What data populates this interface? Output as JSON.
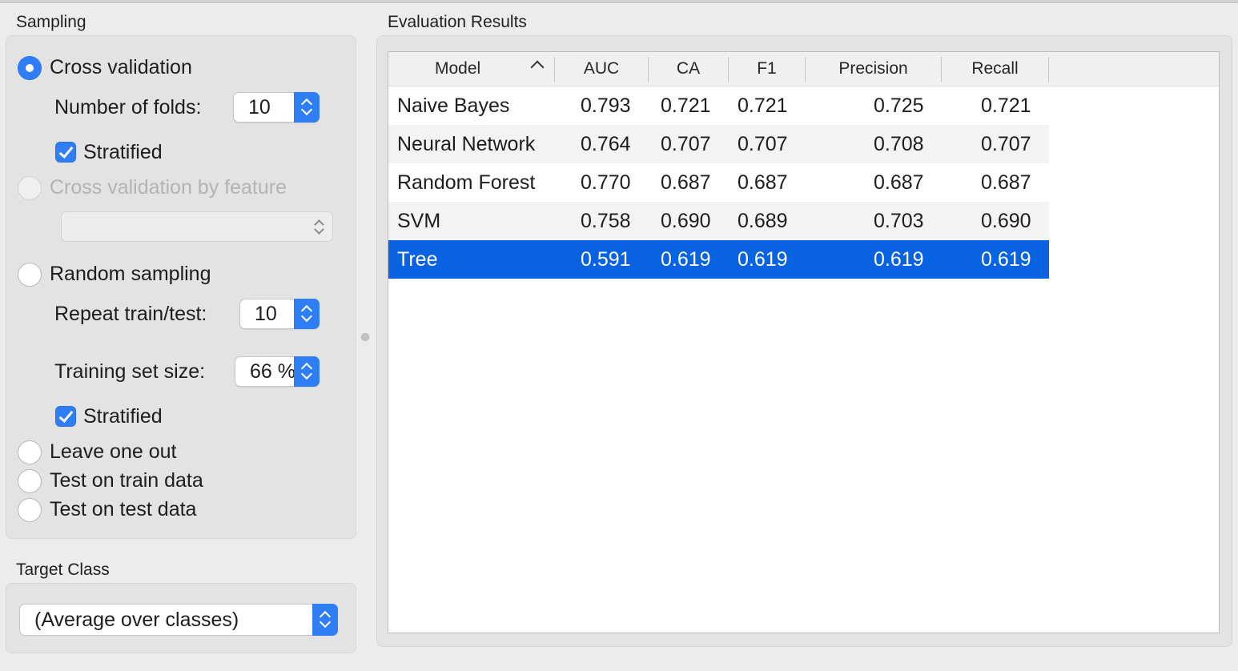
{
  "sampling": {
    "title": "Sampling",
    "cross_validation": {
      "label": "Cross validation",
      "folds_label": "Number of folds:",
      "folds_value": "10",
      "stratified_label": "Stratified"
    },
    "cv_by_feature": {
      "label": "Cross validation by feature",
      "value": ""
    },
    "random_sampling": {
      "label": "Random sampling",
      "repeat_label": "Repeat train/test:",
      "repeat_value": "10",
      "size_label": "Training set size:",
      "size_value": "66 %",
      "stratified_label": "Stratified"
    },
    "leave_one_out": {
      "label": "Leave one out"
    },
    "test_on_train": {
      "label": "Test on train data"
    },
    "test_on_test": {
      "label": "Test on test data"
    },
    "selected": "Cross validation"
  },
  "target_class": {
    "title": "Target Class",
    "value": "(Average over classes)"
  },
  "results": {
    "title": "Evaluation Results",
    "columns": [
      "Model",
      "AUC",
      "CA",
      "F1",
      "Precision",
      "Recall"
    ],
    "sort_column": "Model",
    "rows": [
      [
        "Naive Bayes",
        "0.793",
        "0.721",
        "0.721",
        "0.725",
        "0.721"
      ],
      [
        "Neural Network",
        "0.764",
        "0.707",
        "0.707",
        "0.708",
        "0.707"
      ],
      [
        "Random Forest",
        "0.770",
        "0.687",
        "0.687",
        "0.687",
        "0.687"
      ],
      [
        "SVM",
        "0.758",
        "0.690",
        "0.689",
        "0.703",
        "0.690"
      ],
      [
        "Tree",
        "0.591",
        "0.619",
        "0.619",
        "0.619",
        "0.619"
      ]
    ],
    "selected_row": "Tree"
  },
  "colors": {
    "accent": "#2f7ef6",
    "selection": "#0962e0"
  }
}
